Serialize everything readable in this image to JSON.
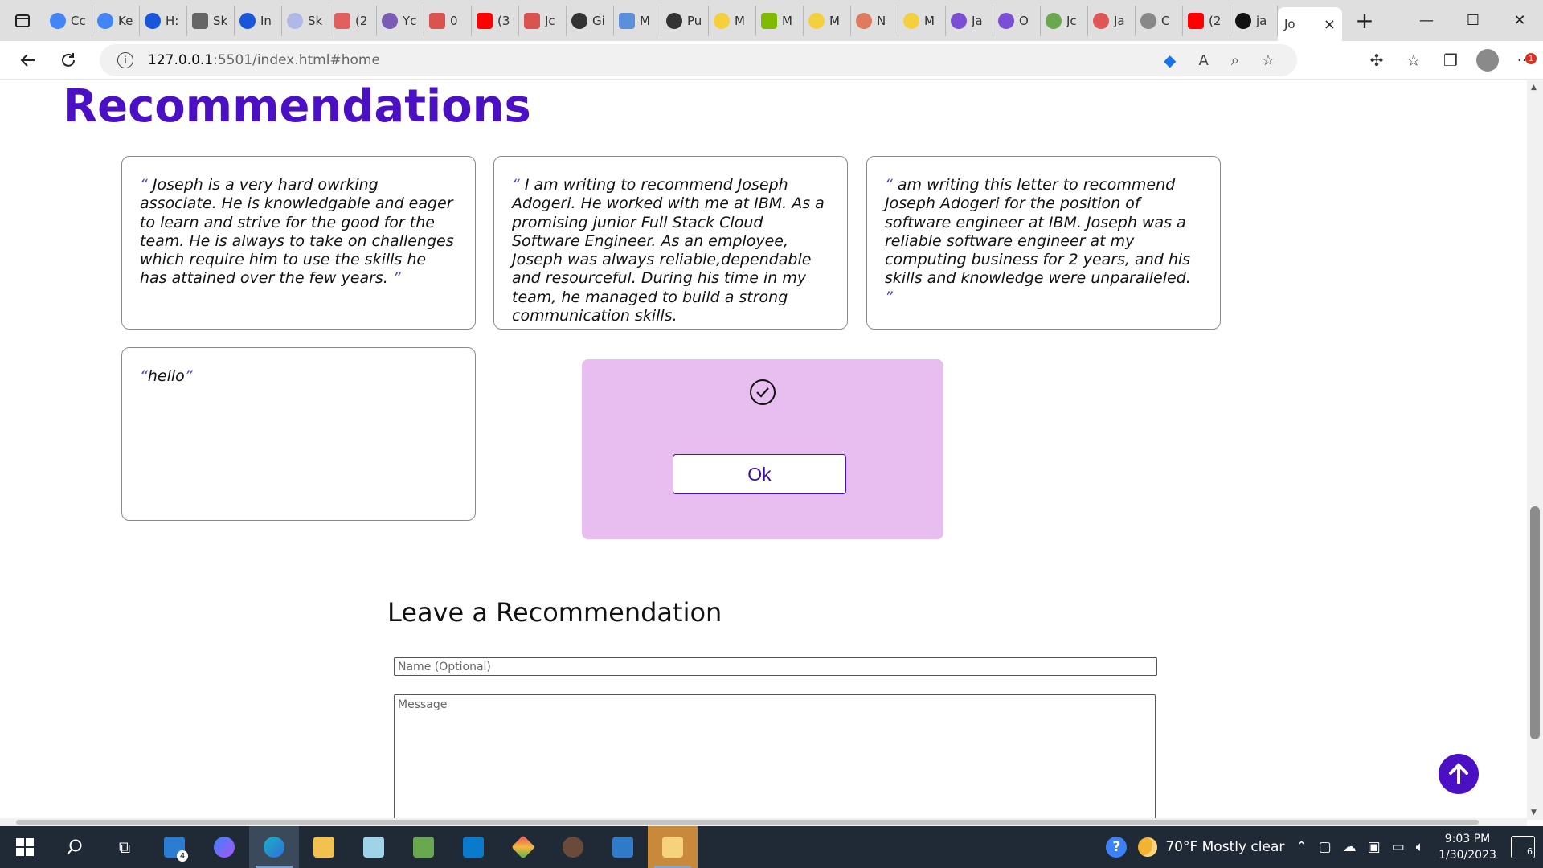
{
  "browser": {
    "tabs": [
      {
        "label": "Cc",
        "icon": "google-icon",
        "color": "#4285f4"
      },
      {
        "label": "Ke",
        "icon": "google-icon",
        "color": "#4285f4"
      },
      {
        "label": "H:",
        "icon": "google-icon",
        "color": "#1a56db"
      },
      {
        "label": "Sk",
        "icon": "document-icon",
        "color": "#666666"
      },
      {
        "label": "In",
        "icon": "google-icon",
        "color": "#1a56db"
      },
      {
        "label": "Sk",
        "icon": "circle-icon",
        "color": "#b0b8e8"
      },
      {
        "label": "(2",
        "icon": "youtube-icon",
        "color": "#e06060"
      },
      {
        "label": "Yc",
        "icon": "app-icon",
        "color": "#7a5bb5"
      },
      {
        "label": "0",
        "icon": "pdf-icon",
        "color": "#d9534f"
      },
      {
        "label": "(3",
        "icon": "youtube-icon",
        "color": "#ff0000"
      },
      {
        "label": "Jc",
        "icon": "pdf-icon",
        "color": "#d9534f"
      },
      {
        "label": "Gi",
        "icon": "github-icon",
        "color": "#333333"
      },
      {
        "label": "M",
        "icon": "teams-icon",
        "color": "#5b8fd9"
      },
      {
        "label": "Pu",
        "icon": "github-icon",
        "color": "#333333"
      },
      {
        "label": "M",
        "icon": "play-icon",
        "color": "#f4d03f"
      },
      {
        "label": "M",
        "icon": "microsoft-icon",
        "color": "#7fba00"
      },
      {
        "label": "M",
        "icon": "play-icon",
        "color": "#f4d03f"
      },
      {
        "label": "N",
        "icon": "circle-icon",
        "color": "#e07a5f"
      },
      {
        "label": "M",
        "icon": "play-icon",
        "color": "#f4d03f"
      },
      {
        "label": "Ja",
        "icon": "flag-icon",
        "color": "#7a4fd6"
      },
      {
        "label": "O",
        "icon": "flag-icon",
        "color": "#7a4fd6"
      },
      {
        "label": "Jc",
        "icon": "link-icon",
        "color": "#6aa84f"
      },
      {
        "label": "Ja",
        "icon": "vue-icon",
        "color": "#e05555"
      },
      {
        "label": "C",
        "icon": "text-icon",
        "color": "#888888"
      },
      {
        "label": "(2",
        "icon": "youtube-icon",
        "color": "#ff0000"
      },
      {
        "label": "ja",
        "icon": "github-icon",
        "color": "#111111"
      }
    ],
    "active_tab": {
      "label": "Jo",
      "close": "×"
    },
    "new_tab": "+",
    "window_controls": {
      "minimize": "—",
      "maximize": "☐",
      "close": "✕"
    },
    "address": {
      "host": "127.0.0.1",
      "path": ":5501/index.html#home"
    }
  },
  "page": {
    "title": "Recommendations",
    "recommendations": [
      {
        "text": "Joseph is a very hard owrking associate. He is knowledgable and eager to learn and strive for the good for the team. He is always to take on challenges which require him to use the skills he has attained over the few years. "
      },
      {
        "text": "I am writing to recommend Joseph Adogeri. He worked with me at IBM. As a promising junior Full Stack Cloud Software Engineer. As an employee, Joseph was always reliable,dependable and resourceful. During his time in my team, he managed to build a strong communication skills."
      },
      {
        "text": "am writing this letter to recommend Joseph Adogeri for the position of software engineer at IBM. Joseph was a reliable software engineer at my computing business for 2 years, and his skills and knowledge were unparalleled. "
      },
      {
        "text": "hello"
      }
    ],
    "quote_open": "“",
    "quote_close": "”",
    "popup": {
      "ok_label": "Ok"
    },
    "form": {
      "title": "Leave a Recommendation",
      "name_placeholder": "Name (Optional)",
      "message_placeholder": "Message"
    },
    "accent_color": "#4b0fc4",
    "popup_color": "#e8bdf0"
  },
  "taskbar": {
    "mail_badge": "4",
    "weather": "70°F  Mostly clear",
    "time": "9:03 PM",
    "date": "1/30/2023",
    "notifications": "6"
  }
}
